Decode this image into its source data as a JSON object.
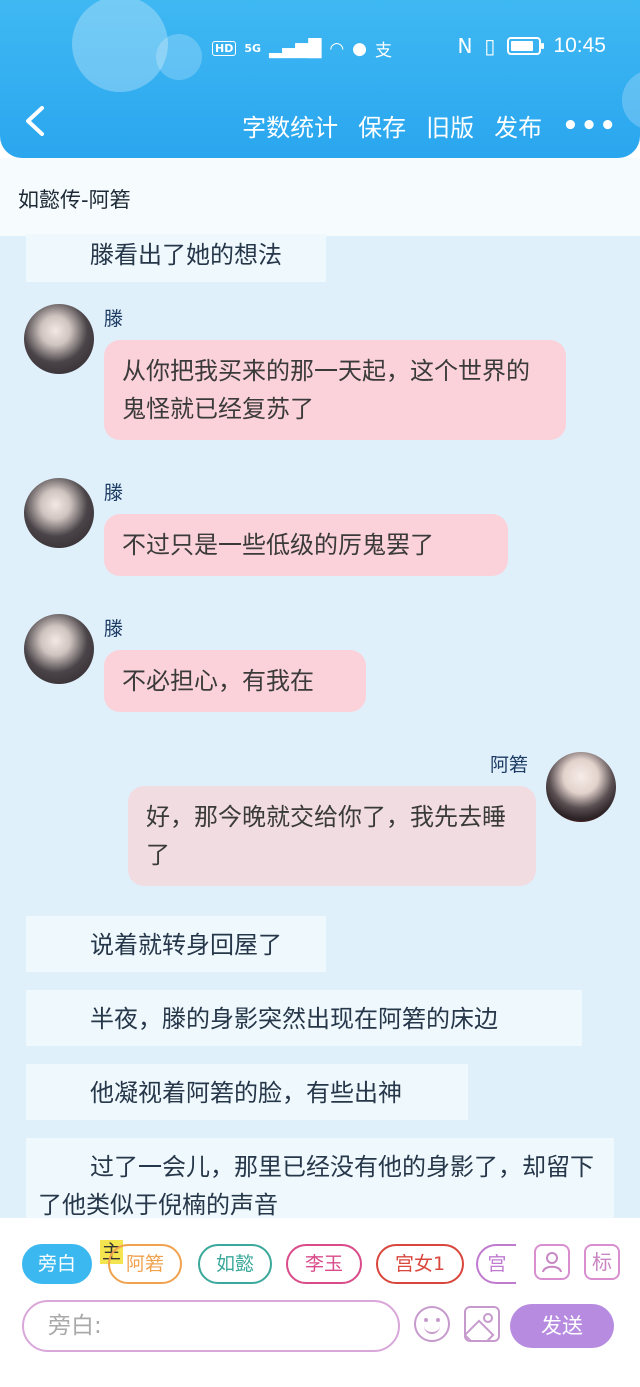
{
  "status": {
    "time": "10:45",
    "network": "5G",
    "hd": "HD"
  },
  "nav": {
    "back": "<",
    "actions": [
      "字数统计",
      "保存",
      "旧版",
      "发布"
    ],
    "more": "•••"
  },
  "doc": {
    "title": "如懿传-阿箬"
  },
  "messages": [
    {
      "type": "narration",
      "text": "滕看出了她的想法"
    },
    {
      "type": "dialog",
      "side": "left",
      "speaker": "滕",
      "text": "从你把我买来的那一天起，这个世界的鬼怪就已经复苏了"
    },
    {
      "type": "dialog",
      "side": "left",
      "speaker": "滕",
      "text": "不过只是一些低级的厉鬼罢了"
    },
    {
      "type": "dialog",
      "side": "left",
      "speaker": "滕",
      "text": "不必担心，有我在"
    },
    {
      "type": "dialog",
      "side": "right",
      "speaker": "阿箬",
      "text": "好，那今晚就交给你了，我先去睡了"
    },
    {
      "type": "narration",
      "text": "说着就转身回屋了"
    },
    {
      "type": "narration",
      "text": "半夜，滕的身影突然出现在阿箬的床边"
    },
    {
      "type": "narration",
      "text": "他凝视着阿箬的脸，有些出神"
    },
    {
      "type": "narration",
      "text": "过了一会儿，那里已经没有他的身影了，却留下了他类似于倪楠的声音"
    }
  ],
  "roles": {
    "main_tag": "主",
    "chips": [
      {
        "label": "旁白",
        "color": "#3bb8f0",
        "active": true
      },
      {
        "label": "阿箬",
        "color": "#f0a24f",
        "active": false
      },
      {
        "label": "如懿",
        "color": "#3aa89a",
        "active": false
      },
      {
        "label": "李玉",
        "color": "#d94b8a",
        "active": false
      },
      {
        "label": "宫女1",
        "color": "#d9463c",
        "active": false
      },
      {
        "label": "宫",
        "color": "#c07ad0",
        "active": false
      }
    ],
    "add_role_icon": "add-role-icon",
    "tag_button": "标"
  },
  "composer": {
    "placeholder": "旁白:",
    "send": "发送"
  }
}
